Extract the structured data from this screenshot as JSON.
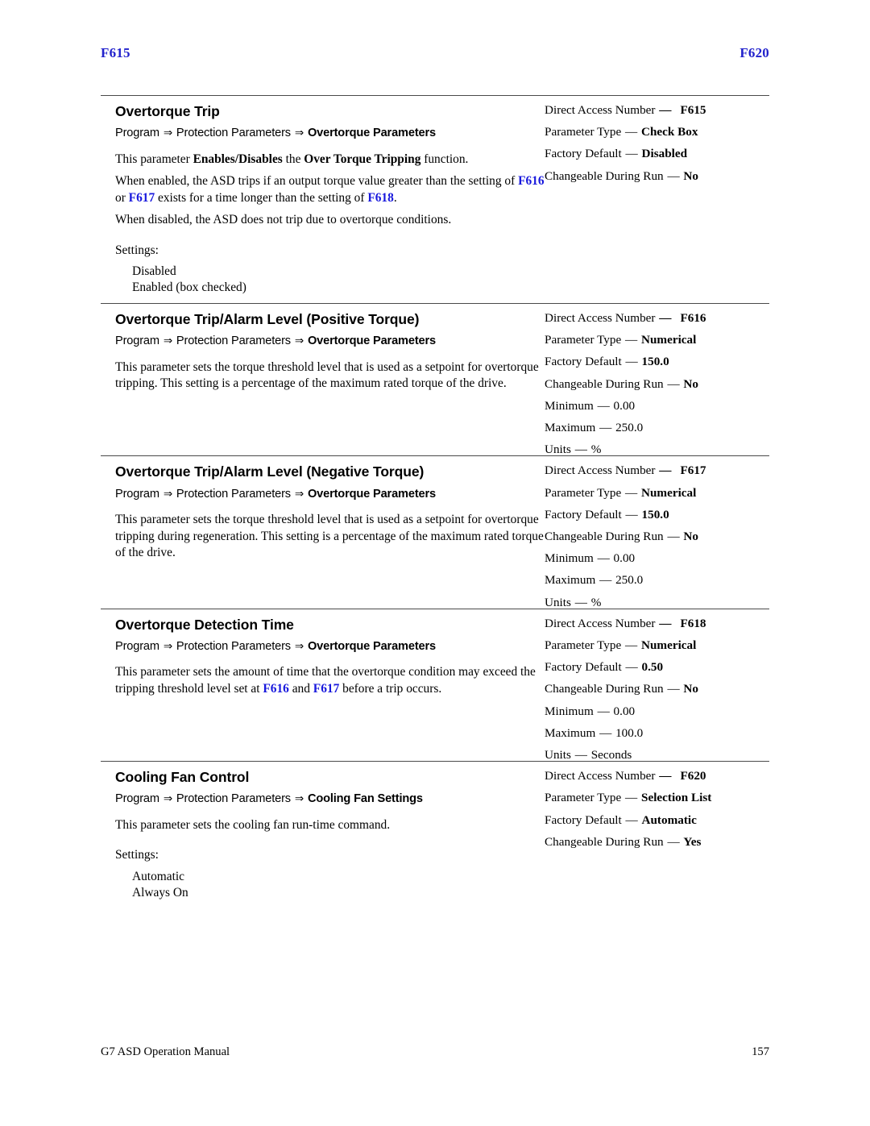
{
  "header": {
    "left_folio": "F615",
    "right_folio": "F620"
  },
  "footer": {
    "manual_title": "G7 ASD Operation Manual",
    "page_number": "157"
  },
  "colors": {
    "reference_blue": "#1818dd",
    "folio_blue": "#2222cc",
    "rule_gray": "#4a4a4a"
  },
  "arrow_glyph": "⇒",
  "em_dash": "—",
  "sections": [
    {
      "title": "Overtorque Trip",
      "breadcrumb": {
        "part1": "Program",
        "part2": "Protection Parameters",
        "part3": "Overtorque Parameters"
      },
      "paragraphs": [
        "This parameter Enables/Disables the Over Torque Tripping function.",
        "When enabled, the ASD trips if an output torque value greater than the setting of F616 or F617 exists for a time longer than the setting of F618.",
        "When disabled, the ASD does not trip due to overtorque conditions."
      ],
      "settings_label": "Settings:",
      "settings": [
        "Disabled",
        "Enabled (box checked)"
      ],
      "specs": [
        {
          "key": "Direct Access Number",
          "value": "F615",
          "all_bold": true
        },
        {
          "key": "Parameter Type",
          "value": "Check Box",
          "value_bold": true
        },
        {
          "key": "Factory Default",
          "value": "Disabled",
          "value_bold": true
        },
        {
          "key": "Changeable During Run",
          "value": "No",
          "value_bold": true
        }
      ]
    },
    {
      "title": "Overtorque Trip/Alarm Level (Positive Torque)",
      "breadcrumb": {
        "part1": "Program",
        "part2": "Protection Parameters",
        "part3": "Overtorque Parameters"
      },
      "paragraphs": [
        "This parameter sets the torque threshold level that is used as a setpoint for overtorque tripping. This setting is a percentage of the maximum rated torque of the drive."
      ],
      "specs": [
        {
          "key": "Direct Access Number",
          "value": "F616",
          "all_bold": true
        },
        {
          "key": "Parameter Type",
          "value": "Numerical",
          "value_bold": true
        },
        {
          "key": "Factory Default",
          "value": "150.0",
          "value_bold": true
        },
        {
          "key": "Changeable During Run",
          "value": "No",
          "value_bold": true
        },
        {
          "key": "Minimum",
          "value": "0.00",
          "value_bold": false
        },
        {
          "key": "Maximum",
          "value": "250.0",
          "value_bold": false
        },
        {
          "key": "Units",
          "value": "%",
          "value_bold": false
        }
      ]
    },
    {
      "title": "Overtorque Trip/Alarm Level (Negative Torque)",
      "breadcrumb": {
        "part1": "Program",
        "part2": "Protection Parameters",
        "part3": "Overtorque Parameters"
      },
      "paragraphs": [
        "This parameter sets the torque threshold level that is used as a setpoint for overtorque tripping during regeneration. This setting is a percentage of the maximum rated torque of the drive."
      ],
      "specs": [
        {
          "key": "Direct Access Number",
          "value": "F617",
          "all_bold": true
        },
        {
          "key": "Parameter Type",
          "value": "Numerical",
          "value_bold": true
        },
        {
          "key": "Factory Default",
          "value": "150.0",
          "value_bold": true
        },
        {
          "key": "Changeable During Run",
          "value": "No",
          "value_bold": true
        },
        {
          "key": "Minimum",
          "value": "0.00",
          "value_bold": false
        },
        {
          "key": "Maximum",
          "value": "250.0",
          "value_bold": false
        },
        {
          "key": "Units",
          "value": "%",
          "value_bold": false
        }
      ]
    },
    {
      "title": "Overtorque Detection Time",
      "breadcrumb": {
        "part1": "Program",
        "part2": "Protection Parameters",
        "part3": "Overtorque Parameters"
      },
      "paragraphs": [
        "This parameter sets the amount of time that the overtorque condition may exceed the tripping threshold level set at F616 and F617 before a trip occurs."
      ],
      "specs": [
        {
          "key": "Direct Access Number",
          "value": "F618",
          "all_bold": true
        },
        {
          "key": "Parameter Type",
          "value": "Numerical",
          "value_bold": true
        },
        {
          "key": "Factory Default",
          "value": "0.50",
          "value_bold": true
        },
        {
          "key": "Changeable During Run",
          "value": "No",
          "value_bold": true
        },
        {
          "key": "Minimum",
          "value": "0.00",
          "value_bold": false
        },
        {
          "key": "Maximum",
          "value": "100.0",
          "value_bold": false
        },
        {
          "key": "Units",
          "value": "Seconds",
          "value_bold": false
        }
      ]
    },
    {
      "title": "Cooling Fan Control",
      "breadcrumb": {
        "part1": "Program",
        "part2": "Protection Parameters",
        "part3": "Cooling Fan Settings"
      },
      "paragraphs": [
        "This parameter sets the cooling fan run-time command."
      ],
      "settings_label": "Settings:",
      "settings": [
        "Automatic",
        "Always On"
      ],
      "specs": [
        {
          "key": "Direct Access Number",
          "value": "F620",
          "all_bold": true
        },
        {
          "key": "Parameter Type",
          "value": "Selection List",
          "value_bold": true
        },
        {
          "key": "Factory Default",
          "value": "Automatic",
          "value_bold": true
        },
        {
          "key": "Changeable During Run",
          "value": "Yes",
          "value_bold": true
        }
      ]
    }
  ]
}
